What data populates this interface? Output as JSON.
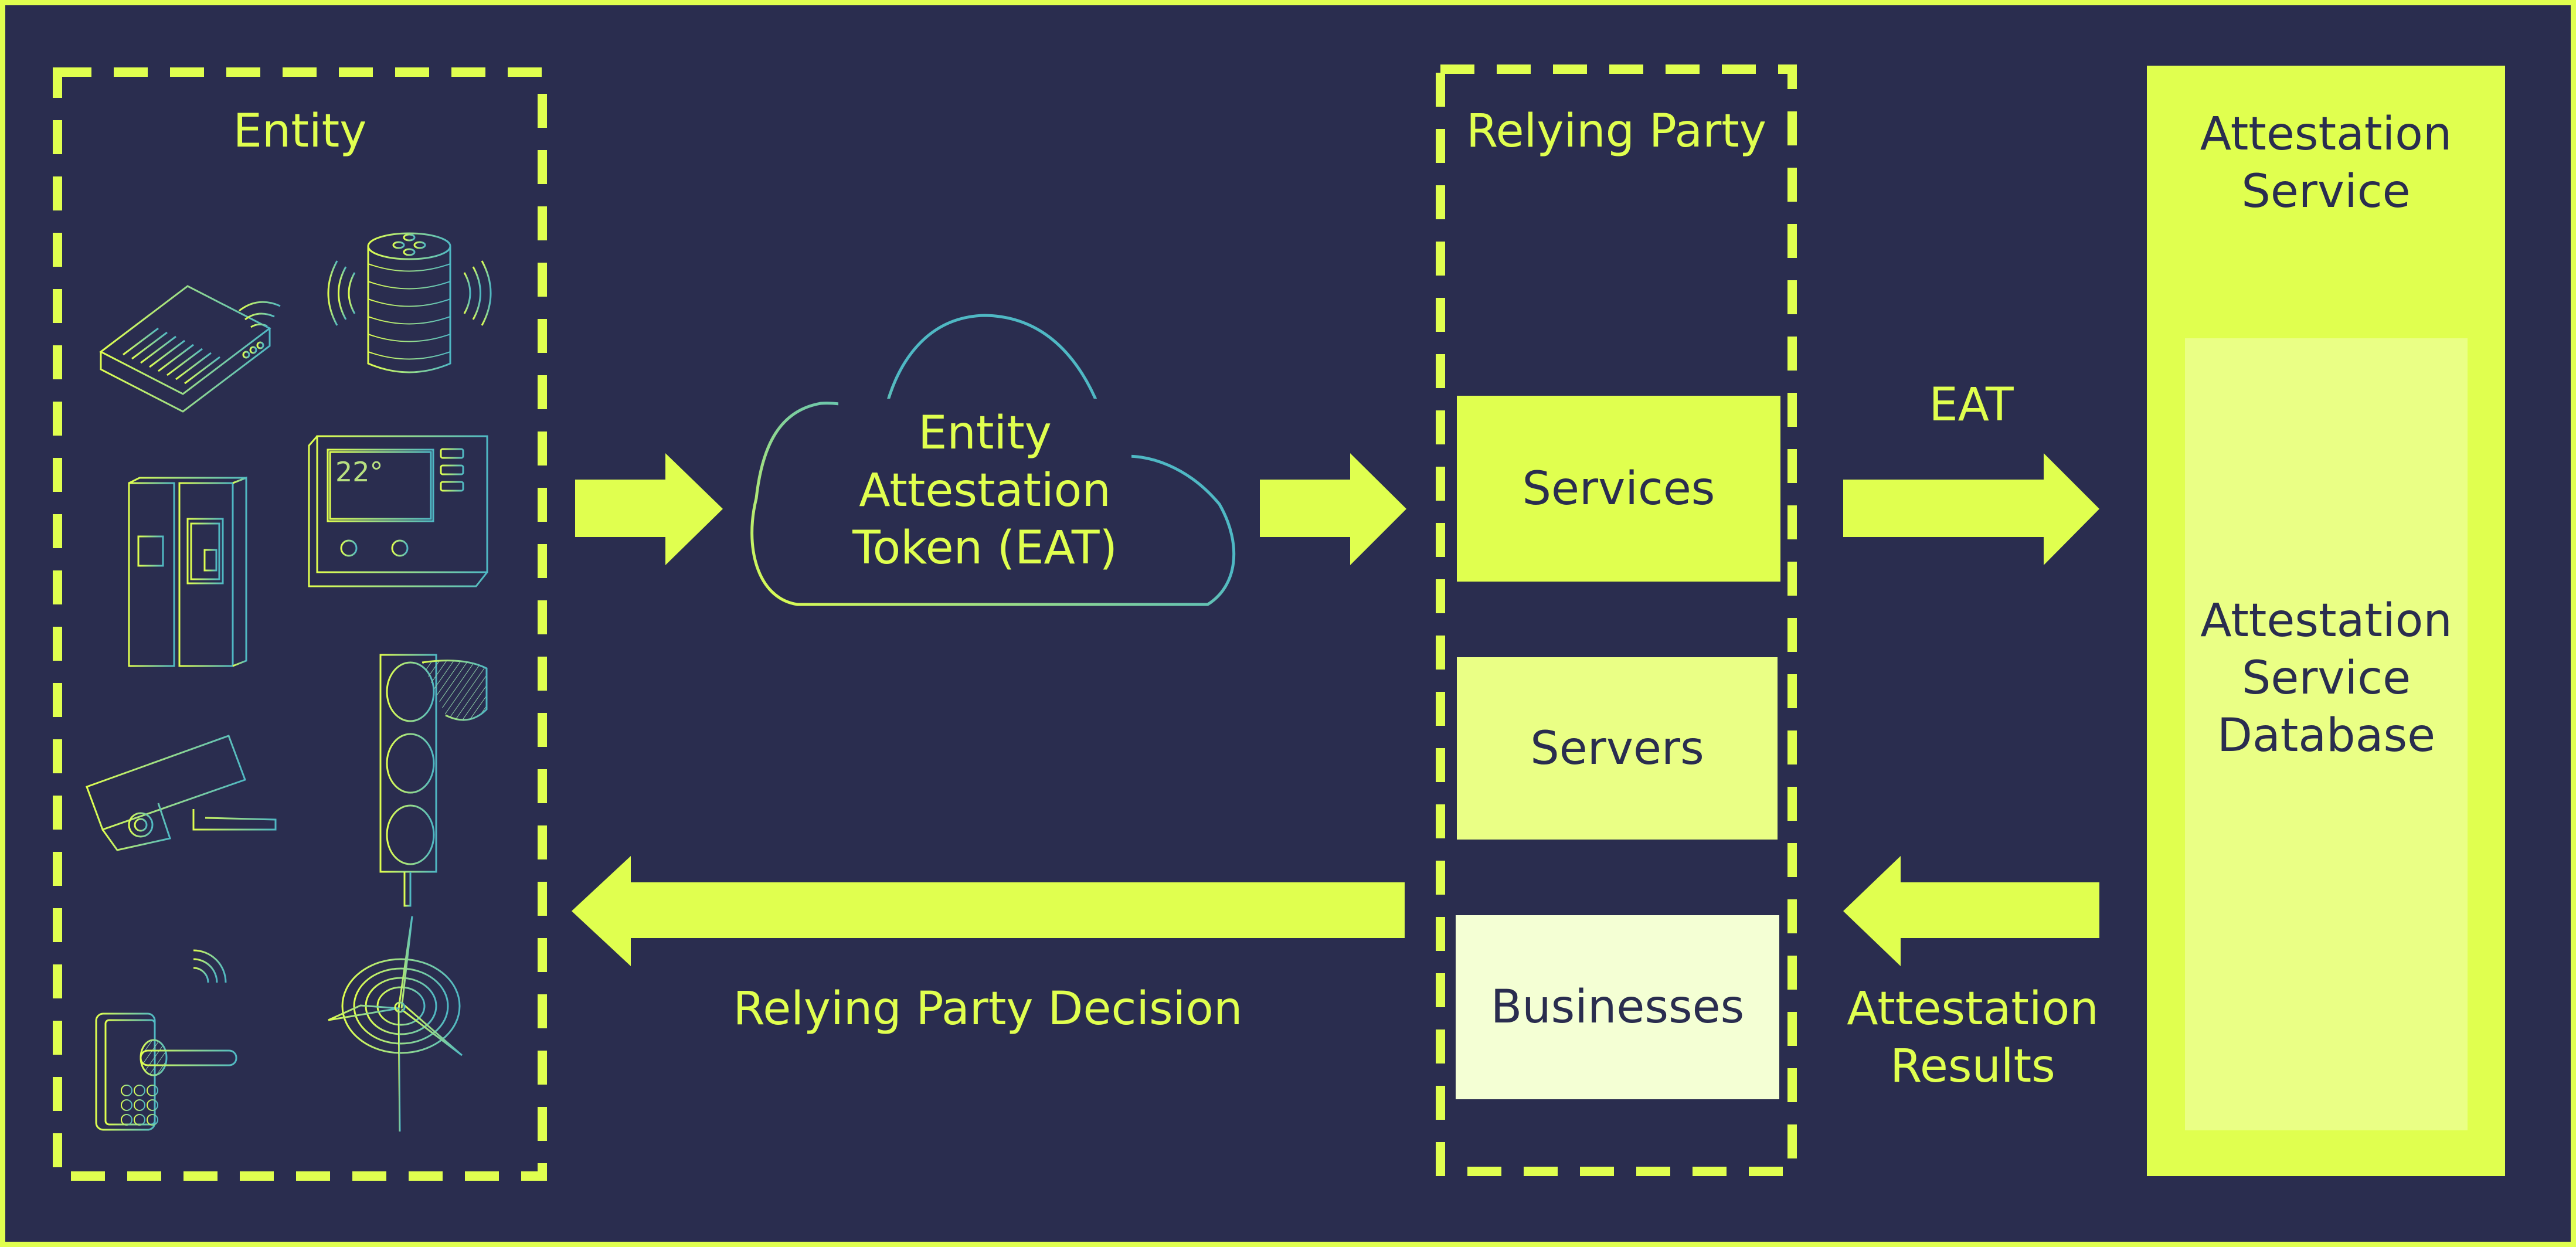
{
  "colors": {
    "background": "#2a2d4f",
    "accent": "#e0ff4f",
    "accent_light": "#eaff85",
    "accent_pale": "#f4ffd4",
    "icon_gradient_start": "#e0ff4f",
    "icon_gradient_end": "#4fb8c4"
  },
  "entity": {
    "title": "Entity",
    "devices": [
      {
        "name": "router",
        "icon": "router-icon"
      },
      {
        "name": "smart speaker",
        "icon": "smart-speaker-icon"
      },
      {
        "name": "refrigerator",
        "icon": "refrigerator-icon"
      },
      {
        "name": "thermostat",
        "icon": "thermostat-icon",
        "display": "22°"
      },
      {
        "name": "security camera",
        "icon": "security-camera-icon"
      },
      {
        "name": "traffic light",
        "icon": "traffic-light-icon"
      },
      {
        "name": "smart lock",
        "icon": "smart-lock-icon",
        "keys": [
          "1",
          "2",
          "3",
          "4",
          "5",
          "6",
          "7",
          "8",
          "9"
        ]
      },
      {
        "name": "wind turbine",
        "icon": "wind-turbine-icon"
      }
    ]
  },
  "token": {
    "lines": [
      "Entity",
      "Attestation",
      "Token (EAT)"
    ],
    "icon": "cloud-icon"
  },
  "relying_party": {
    "title": "Relying Party",
    "items": [
      {
        "label": "Services"
      },
      {
        "label": "Servers"
      },
      {
        "label": "Businesses"
      }
    ]
  },
  "attestation_service": {
    "title_lines": [
      "Attestation",
      "Service"
    ],
    "database_lines": [
      "Attestation",
      "Service",
      "Database"
    ]
  },
  "flows": {
    "eat_label": "EAT",
    "results_label_lines": [
      "Attestation",
      "Results"
    ],
    "decision_label": "Relying Party Decision"
  }
}
